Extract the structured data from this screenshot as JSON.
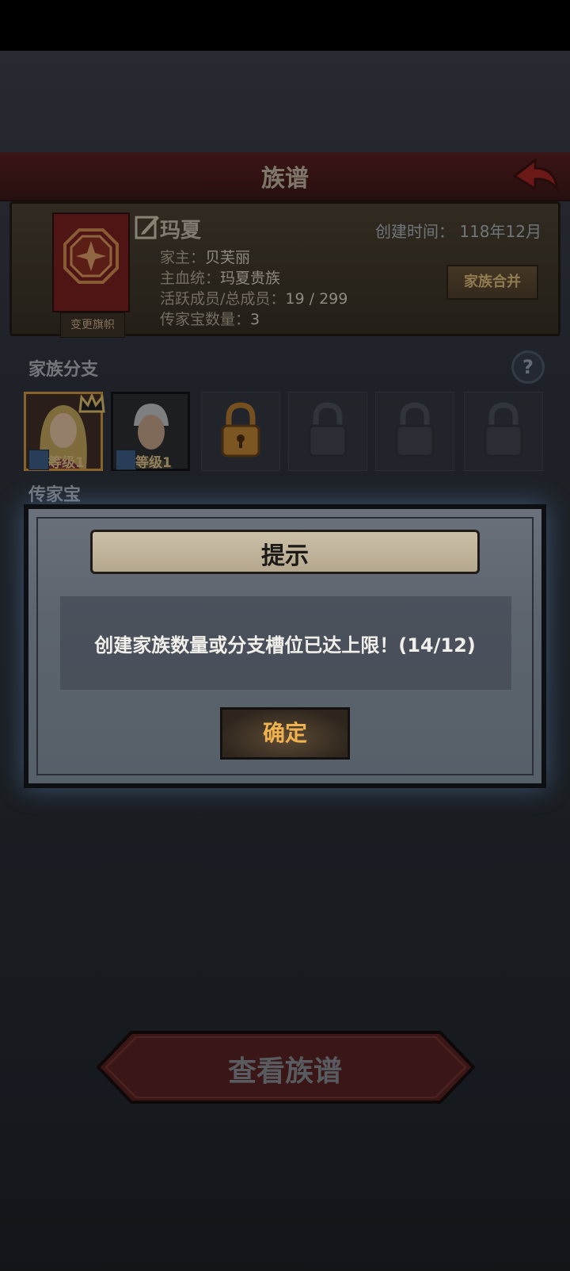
{
  "header": {
    "title": "族谱"
  },
  "family": {
    "name": "玛夏",
    "create_time_label": "创建时间：",
    "create_time_value": "118年12月",
    "head_label": "家主：",
    "head_value": "贝芙丽",
    "bloodline_label": "主血统：",
    "bloodline_value": "玛夏贵族",
    "members_label": "活跃成员/总成员：",
    "members_value": "19 / 299",
    "heirloom_count_label": "传家宝数量：",
    "heirloom_count_value": "3",
    "change_flag_label": "变更旗帜",
    "merge_label": "家族合并"
  },
  "branches": {
    "title": "家族分支",
    "help_label": "?",
    "members": [
      {
        "level": "等级1",
        "crowned": true
      },
      {
        "level": "等级1",
        "crowned": false
      }
    ],
    "locked_slot_count": 4
  },
  "heirloom_section": {
    "title": "传家宝"
  },
  "dialog": {
    "title": "提示",
    "message": "创建家族数量或分支槽位已达上限！(14/12)",
    "confirm_label": "确定"
  },
  "bottom": {
    "view_tree_label": "查看族谱"
  },
  "colors": {
    "banner_red": "#7b1c1a",
    "title_bar": "#4a1715",
    "accent_gold": "#e6bf7a",
    "confirm_text": "#f0b14f"
  }
}
